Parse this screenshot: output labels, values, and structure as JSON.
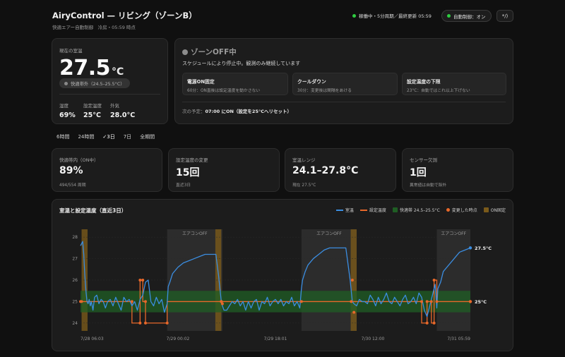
{
  "header": {
    "title": "AiryControl — リビング（ゾーンB）",
    "subtitle": "快適エアー自動制御　冷房・05:59 時点",
    "status": "稼働中・5分周期／最終更新 05:59",
    "auto_control": "自動制御：オン",
    "icon_button": "*/)"
  },
  "current": {
    "label": "現在の室温",
    "temp": "27.5",
    "unit": "°C",
    "comfort": "快適帯外（24.5–25.5°C）",
    "humidity_label": "湿度",
    "humidity": "69%",
    "setpoint_label": "設定温度",
    "setpoint": "25°C",
    "outdoor_label": "外気",
    "outdoor": "28.0°C"
  },
  "zone": {
    "title": "ゾーンOFF中",
    "description": "スケジュールにより停止中。観測のみ継続しています",
    "rules": [
      {
        "title": "電源ON固定",
        "detail": "60分：ON直後は設定温度を動かさない"
      },
      {
        "title": "クールダウン",
        "detail": "30分：変更後は間隔をあける"
      },
      {
        "title": "設定温度の下限",
        "detail": "23°C：自動ではこれ以上下げない"
      }
    ],
    "next_label": "次の予定：",
    "next_value": "07:00 にON（設定を25°Cへリセット）"
  },
  "tabs": [
    {
      "label": "6時間",
      "active": false
    },
    {
      "label": "24時間",
      "active": false
    },
    {
      "label": "✓3日",
      "active": true
    },
    {
      "label": "7日",
      "active": false
    },
    {
      "label": "全期間",
      "active": false
    }
  ],
  "stats": [
    {
      "label": "快適帯内（ON中）",
      "value": "89%",
      "sub": "494/554 周期"
    },
    {
      "label": "設定温度の変更",
      "value": "15回",
      "sub": "直近3日"
    },
    {
      "label": "室温レンジ",
      "value": "24.1–27.8°C",
      "sub": "現在 27.5°C"
    },
    {
      "label": "センサー欠測",
      "value": "1回",
      "sub": "異常値は自動で除外"
    }
  ],
  "chart_data": {
    "type": "line",
    "title": "室温と設定温度（直近3日）",
    "legend": [
      "室温",
      "設定温度",
      "快適帯 24.5–25.5°C",
      "変更した時点",
      "ON固定"
    ],
    "colors": {
      "room": "#3b8de0",
      "setpoint": "#e8682a",
      "band": "#1f5e24",
      "change": "#e8682a",
      "on_fixed": "#7a5a1a",
      "off": "#2c2c2c"
    },
    "x_ticks": [
      "7/28 06:03",
      "7/29 00:02",
      "7/29 18:01",
      "7/30 12:00",
      "7/31 05:59"
    ],
    "x_range_hours": [
      0,
      72
    ],
    "y_ticks": [
      24,
      25,
      26,
      27,
      28
    ],
    "ylim": [
      23.7,
      28.3
    ],
    "comfort_band": [
      24.5,
      25.5
    ],
    "off_label": "エアコンOFF",
    "off_periods": [
      [
        16.0,
        26.2
      ],
      [
        40.8,
        51.0
      ],
      [
        65.8,
        72
      ]
    ],
    "on_fixed_periods": [
      [
        0.2,
        1.3
      ],
      [
        24.9,
        26.0
      ],
      [
        49.9,
        51.0
      ]
    ],
    "room_series": {
      "name": "室温",
      "x": [
        0,
        0.2,
        0.4,
        0.6,
        0.8,
        1,
        1.2,
        1.4,
        1.6,
        1.8,
        2,
        2.3,
        2.6,
        3,
        3.4,
        3.8,
        4.2,
        4.6,
        5,
        5.5,
        6,
        6.5,
        7,
        7.5,
        8,
        8.5,
        9,
        9.5,
        10,
        10.5,
        11,
        11.5,
        12,
        12.5,
        13,
        13.5,
        14,
        14.5,
        15,
        15.5,
        16,
        16.2,
        16.5,
        17,
        18,
        19,
        20,
        21,
        22,
        23,
        24,
        25,
        25.5,
        26,
        26.2,
        26.5,
        27,
        27.5,
        28,
        28.5,
        29,
        29.5,
        30,
        30.5,
        31,
        31.5,
        32,
        32.5,
        33,
        33.5,
        34,
        34.5,
        35,
        35.5,
        36,
        36.5,
        37,
        37.5,
        38,
        38.5,
        39,
        39.5,
        40,
        40.5,
        40.8,
        41,
        41.5,
        42,
        43,
        44,
        45,
        46,
        47,
        48,
        49,
        49.8,
        50,
        50.2,
        50.5,
        51,
        51.5,
        52,
        52.5,
        53,
        53.5,
        54,
        54.5,
        55,
        55.5,
        56,
        56.5,
        57,
        57.5,
        58,
        58.5,
        59,
        59.5,
        60,
        60.5,
        61,
        61.5,
        62,
        62.5,
        63,
        63.5,
        64,
        64.5,
        65,
        65.5,
        65.8,
        66,
        66.5,
        67,
        68,
        69,
        70,
        71,
        72
      ],
      "y": [
        27.6,
        27.7,
        27.8,
        27.2,
        26.2,
        25.5,
        25.0,
        24.9,
        25.1,
        24.8,
        25.0,
        24.6,
        25.2,
        25.3,
        24.9,
        25.1,
        25.0,
        24.7,
        25.0,
        25.1,
        24.8,
        25.2,
        24.9,
        24.6,
        25.2,
        25.0,
        25.1,
        24.8,
        25.0,
        24.6,
        25.1,
        25.3,
        25.9,
        26.0,
        25.0,
        24.8,
        25.2,
        24.9,
        25.1,
        24.5,
        24.9,
        25.7,
        25.9,
        26.3,
        26.6,
        26.8,
        26.9,
        27.0,
        27.1,
        27.2,
        27.2,
        27.2,
        26.2,
        25.0,
        24.8,
        24.6,
        24.6,
        24.8,
        25.0,
        24.9,
        25.1,
        24.8,
        25.0,
        24.6,
        25.0,
        24.7,
        25.0,
        25.1,
        24.6,
        25.0,
        24.9,
        25.2,
        24.8,
        25.0,
        25.1,
        24.9,
        25.1,
        24.8,
        25.0,
        24.9,
        25.2,
        24.8,
        25.0,
        24.7,
        25.6,
        26.0,
        26.4,
        26.7,
        27.0,
        27.2,
        27.4,
        27.5,
        27.5,
        27.5,
        27.5,
        26.0,
        25.5,
        25.0,
        24.9,
        24.8,
        25.1,
        25.0,
        25.0,
        24.9,
        25.3,
        25.1,
        24.8,
        25.2,
        24.9,
        25.1,
        25.4,
        25.0,
        24.9,
        25.2,
        25.0,
        24.8,
        25.1,
        25.3,
        24.9,
        25.0,
        25.2,
        24.9,
        25.4,
        25.2,
        24.6,
        24.3,
        24.8,
        25.3,
        25.8,
        24.7,
        25.6,
        25.9,
        26.4,
        26.7,
        27.0,
        27.3,
        27.4,
        27.5
      ]
    },
    "setpoint_series": {
      "name": "設定温度",
      "x": [
        0,
        9.5,
        9.5,
        11.0,
        11.0,
        11.5,
        11.5,
        12.0,
        12.0,
        16.0,
        16.0,
        26.0,
        26.0,
        40.8,
        40.8,
        51.0,
        51.0,
        63.0,
        63.0,
        64.0,
        64.0,
        64.8,
        64.8,
        65.3,
        65.3,
        65.8,
        65.8,
        72
      ],
      "y": [
        25,
        25,
        24,
        24,
        26,
        26,
        25,
        25,
        24,
        24,
        25,
        25,
        25,
        25,
        25,
        25,
        25,
        25,
        24,
        24,
        25,
        25,
        24,
        24,
        26,
        26,
        25,
        25
      ]
    },
    "change_points": {
      "x": [
        0,
        0.2,
        9.5,
        11.0,
        11.0,
        11.5,
        12.0,
        12.0,
        16.0,
        26.0,
        26.0,
        26.2,
        40.8,
        50.0,
        50.2,
        50.5,
        63.0,
        64.0,
        64.0,
        64.8,
        65.3,
        65.3,
        65.8
      ],
      "y": [
        25,
        25,
        25,
        24,
        26,
        26,
        25,
        24,
        24,
        25,
        25,
        24.9,
        25.0,
        25,
        26,
        24.5,
        25,
        24,
        25,
        25,
        24,
        26,
        25
      ]
    },
    "end_labels": {
      "room": "27.5°C",
      "setpoint": "25°C"
    }
  }
}
